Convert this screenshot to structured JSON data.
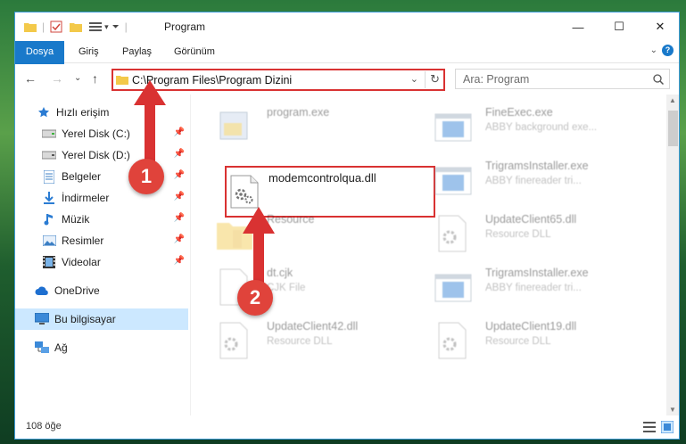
{
  "window": {
    "title": "Program"
  },
  "ribbon": {
    "tabs": [
      "Dosya",
      "Giriş",
      "Paylaş",
      "Görünüm"
    ]
  },
  "address": {
    "path": "C:\\Program Files\\Program Dizini"
  },
  "search": {
    "placeholder": "Ara: Program"
  },
  "sidebar": {
    "quick_access": "Hızlı erişim",
    "items": [
      {
        "label": "Yerel Disk (C:)",
        "icon": "drive-icon",
        "pinned": true
      },
      {
        "label": "Yerel Disk (D:)",
        "icon": "drive-icon",
        "pinned": true
      },
      {
        "label": "Belgeler",
        "icon": "documents-icon",
        "pinned": true
      },
      {
        "label": "İndirmeler",
        "icon": "downloads-icon",
        "pinned": true
      },
      {
        "label": "Müzik",
        "icon": "music-icon",
        "pinned": true
      },
      {
        "label": "Resimler",
        "icon": "pictures-icon",
        "pinned": true
      },
      {
        "label": "Videolar",
        "icon": "videos-icon",
        "pinned": true
      }
    ],
    "onedrive": "OneDrive",
    "this_pc": "Bu bilgisayar",
    "network": "Ağ"
  },
  "files": {
    "program": {
      "name": "program.exe",
      "desc": ""
    },
    "fineexec": {
      "name": "FineExec.exe",
      "desc": "ABBY background exe..."
    },
    "modem": {
      "name": "modemcontrolqua.dll",
      "desc": ""
    },
    "trigrams1": {
      "name": "TrigramsInstaller.exe",
      "desc": "ABBY finereader tri..."
    },
    "resource": {
      "name": "Resource",
      "desc": ""
    },
    "update65": {
      "name": "UpdateClient65.dll",
      "desc": "Resource DLL"
    },
    "cjk": {
      "name": "dt.cjk",
      "desc": "CJK File"
    },
    "trigrams2": {
      "name": "TrigramsInstaller.exe",
      "desc": "ABBY finereader tri..."
    },
    "update42": {
      "name": "UpdateClient42.dll",
      "desc": "Resource DLL"
    },
    "update19": {
      "name": "UpdateClient19.dll",
      "desc": "Resource DLL"
    }
  },
  "status": {
    "count": "108 öğe"
  },
  "annotations": {
    "step1": "1",
    "step2": "2"
  },
  "colors": {
    "accent": "#1979ca",
    "highlight": "#d93232",
    "selected": "#cce8ff"
  }
}
